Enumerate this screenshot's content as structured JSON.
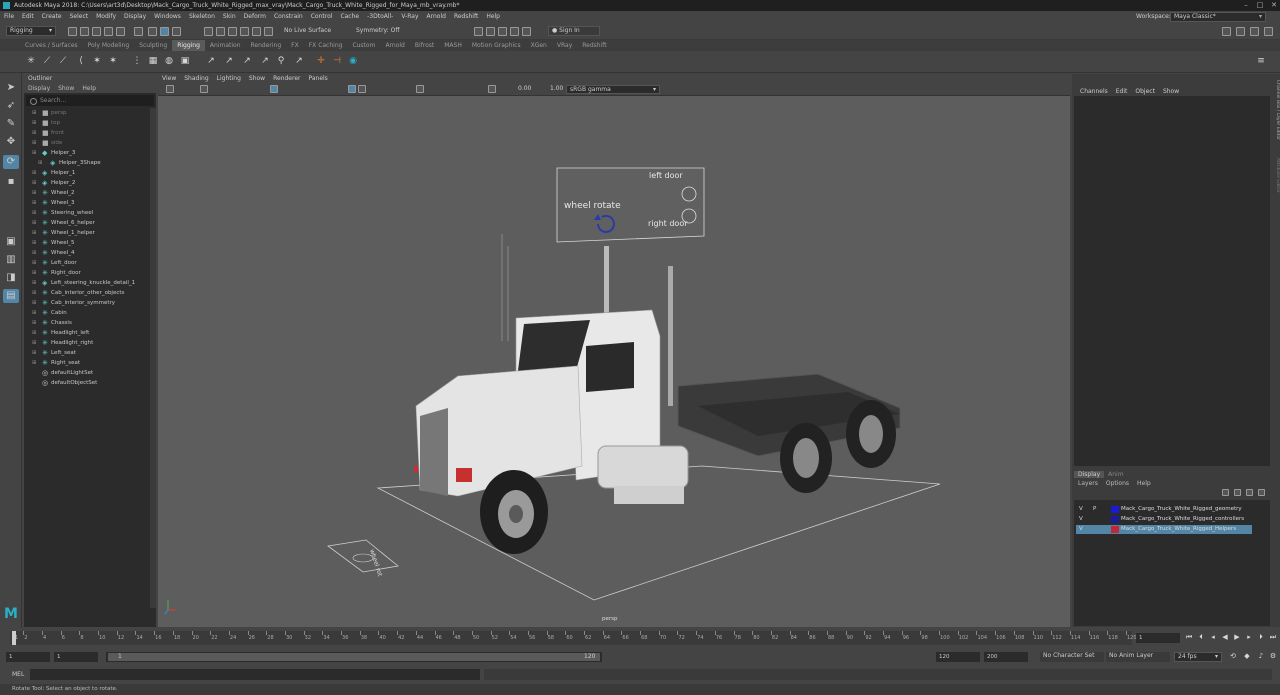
{
  "title": "Autodesk Maya 2018: C:\\Users\\art3d\\Desktop\\Mack_Cargo_Truck_White_Rigged_max_vray\\Mack_Cargo_Truck_White_Rigged_for_Maya_mb_vray.mb*",
  "menu": [
    "File",
    "Edit",
    "Create",
    "Select",
    "Modify",
    "Display",
    "Windows",
    "Skeleton",
    "Skin",
    "Deform",
    "Constrain",
    "Control",
    "Cache",
    "-3DtoAll-",
    "V-Ray",
    "Arnold",
    "Redshift",
    "Help"
  ],
  "workspace_label": "Workspace:",
  "workspace_value": "Maya Classic*",
  "mode_menu": "Rigging",
  "live_surface": "No Live Surface",
  "symmetry": "Symmetry: Off",
  "sign_in": "Sign In",
  "shelf_tabs": [
    "Curves / Surfaces",
    "Poly Modeling",
    "Sculpting",
    "Rigging",
    "Animation",
    "Rendering",
    "FX",
    "FX Caching",
    "Custom",
    "Arnold",
    "Bifrost",
    "MASH",
    "Motion Graphics",
    "XGen",
    "VRay",
    "Redshift"
  ],
  "shelf_active": "Rigging",
  "outliner": {
    "title": "Outliner",
    "menu": [
      "Display",
      "Show",
      "Help"
    ],
    "search_placeholder": "Search...",
    "items": [
      {
        "label": "persp",
        "depth": 1,
        "icon": "camera",
        "dim": true
      },
      {
        "label": "top",
        "depth": 1,
        "icon": "camera",
        "dim": true
      },
      {
        "label": "front",
        "depth": 1,
        "icon": "camera",
        "dim": true
      },
      {
        "label": "side",
        "depth": 1,
        "icon": "camera",
        "dim": true
      },
      {
        "label": "Helper_3",
        "depth": 1,
        "icon": "group"
      },
      {
        "label": "Helper_3Shape",
        "depth": 2,
        "icon": "shape"
      },
      {
        "label": "Helper_1",
        "depth": 1,
        "icon": "shape"
      },
      {
        "label": "Helper_2",
        "depth": 1,
        "icon": "shape"
      },
      {
        "label": "Wheel_2",
        "depth": 1,
        "icon": "joint"
      },
      {
        "label": "Wheel_3",
        "depth": 1,
        "icon": "joint"
      },
      {
        "label": "Steering_wheel",
        "depth": 1,
        "icon": "joint"
      },
      {
        "label": "Wheel_6_helper",
        "depth": 1,
        "icon": "joint"
      },
      {
        "label": "Wheel_1_helper",
        "depth": 1,
        "icon": "joint"
      },
      {
        "label": "Wheel_5",
        "depth": 1,
        "icon": "joint"
      },
      {
        "label": "Wheel_4",
        "depth": 1,
        "icon": "joint"
      },
      {
        "label": "Left_door",
        "depth": 1,
        "icon": "joint"
      },
      {
        "label": "Right_door",
        "depth": 1,
        "icon": "joint"
      },
      {
        "label": "Left_steering_knuckle_detail_1",
        "depth": 1,
        "icon": "shape"
      },
      {
        "label": "Cab_interior_other_objects",
        "depth": 1,
        "icon": "joint"
      },
      {
        "label": "Cab_interior_symmetry",
        "depth": 1,
        "icon": "joint"
      },
      {
        "label": "Cabin",
        "depth": 1,
        "icon": "joint"
      },
      {
        "label": "Chassis",
        "depth": 1,
        "icon": "joint"
      },
      {
        "label": "Headlight_left",
        "depth": 1,
        "icon": "joint"
      },
      {
        "label": "Headlight_right",
        "depth": 1,
        "icon": "joint"
      },
      {
        "label": "Left_seat",
        "depth": 1,
        "icon": "joint"
      },
      {
        "label": "Right_seat",
        "depth": 1,
        "icon": "joint"
      },
      {
        "label": "defaultLightSet",
        "depth": 0,
        "icon": "set"
      },
      {
        "label": "defaultObjectSet",
        "depth": 0,
        "icon": "set"
      }
    ]
  },
  "viewport": {
    "menu": [
      "View",
      "Shading",
      "Lighting",
      "Show",
      "Renderer",
      "Panels"
    ],
    "exposure": "0.00",
    "gamma": "1.00",
    "colorspace": "sRGB gamma",
    "camera_label": "persp",
    "rig_text": {
      "wheel_rotate": "wheel rotate",
      "left_door": "left door",
      "right_door": "right door",
      "wheel_rot": "wheel rot"
    }
  },
  "channelbox": {
    "menu": [
      "Channels",
      "Edit",
      "Object",
      "Show"
    ],
    "side_tabs": [
      "Channel Box / Layer Editor",
      "Attribute Editor"
    ]
  },
  "layers": {
    "tabs": [
      "Display",
      "Anim"
    ],
    "menu": [
      "Layers",
      "Options",
      "Help"
    ],
    "rows": [
      {
        "v": "V",
        "p": "P",
        "color": "#1a1ad8",
        "name": "Mack_Cargo_Truck_White_Rigged_geometry",
        "selected": false
      },
      {
        "v": "V",
        "p": "",
        "color": "#1a1a9a",
        "name": "Mack_Cargo_Truck_White_Rigged_controllers",
        "selected": false
      },
      {
        "v": "V",
        "p": "",
        "color": "#c0283a",
        "name": "Mack_Cargo_Truck_White_Rigged_Helpers",
        "selected": true
      }
    ]
  },
  "timeline": {
    "ticks": [
      "1",
      "2",
      "4",
      "6",
      "8",
      "10",
      "12",
      "14",
      "16",
      "18",
      "20",
      "22",
      "24",
      "26",
      "28",
      "30",
      "32",
      "34",
      "36",
      "38",
      "40",
      "42",
      "44",
      "46",
      "48",
      "50",
      "52",
      "54",
      "56",
      "58",
      "60",
      "62",
      "64",
      "66",
      "68",
      "70",
      "72",
      "74",
      "76",
      "78",
      "80",
      "82",
      "84",
      "86",
      "88",
      "90",
      "92",
      "94",
      "96",
      "98",
      "100",
      "102",
      "104",
      "106",
      "108",
      "110",
      "112",
      "114",
      "116",
      "118",
      "120"
    ],
    "current_frame": "1"
  },
  "range": {
    "start": "1",
    "playback_start": "1",
    "slider_start": "1",
    "slider_end": "120",
    "playback_end": "120",
    "end": "200",
    "character_set": "No Character Set",
    "anim_layer": "No Anim Layer",
    "fps": "24 fps"
  },
  "cmd_label": "MEL",
  "help_text": "Rotate Tool: Select an object to rotate."
}
